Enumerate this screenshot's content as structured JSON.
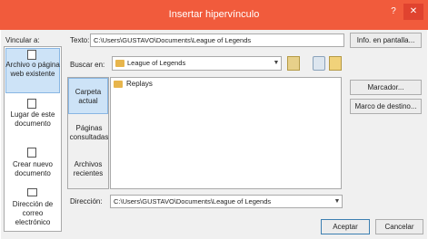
{
  "window": {
    "title": "Insertar hipervínculo",
    "help_label": "?",
    "close_label": "✕"
  },
  "link_to": {
    "label": "Vincular a:",
    "items": [
      {
        "label": "Archivo o página web existente"
      },
      {
        "label": "Lugar de este documento"
      },
      {
        "label": "Crear nuevo documento"
      },
      {
        "label": "Dirección de correo electrónico"
      }
    ]
  },
  "text_field": {
    "label": "Texto:",
    "value": "C:\\Users\\GUSTAVO\\Documents\\League of Legends"
  },
  "screen_tip_button": "Info. en pantalla...",
  "look_in": {
    "label": "Buscar en:",
    "value": "League of Legends"
  },
  "browse_tabs": [
    {
      "label": "Carpeta actual"
    },
    {
      "label": "Páginas consultadas"
    },
    {
      "label": "Archivos recientes"
    }
  ],
  "file_list": [
    "Replays"
  ],
  "right_buttons": {
    "bookmark": "Marcador...",
    "target_frame": "Marco de destino..."
  },
  "address": {
    "label": "Dirección:",
    "value": "C:\\Users\\GUSTAVO\\Documents\\League of Legends"
  },
  "footer": {
    "ok": "Aceptar",
    "cancel": "Cancelar"
  }
}
